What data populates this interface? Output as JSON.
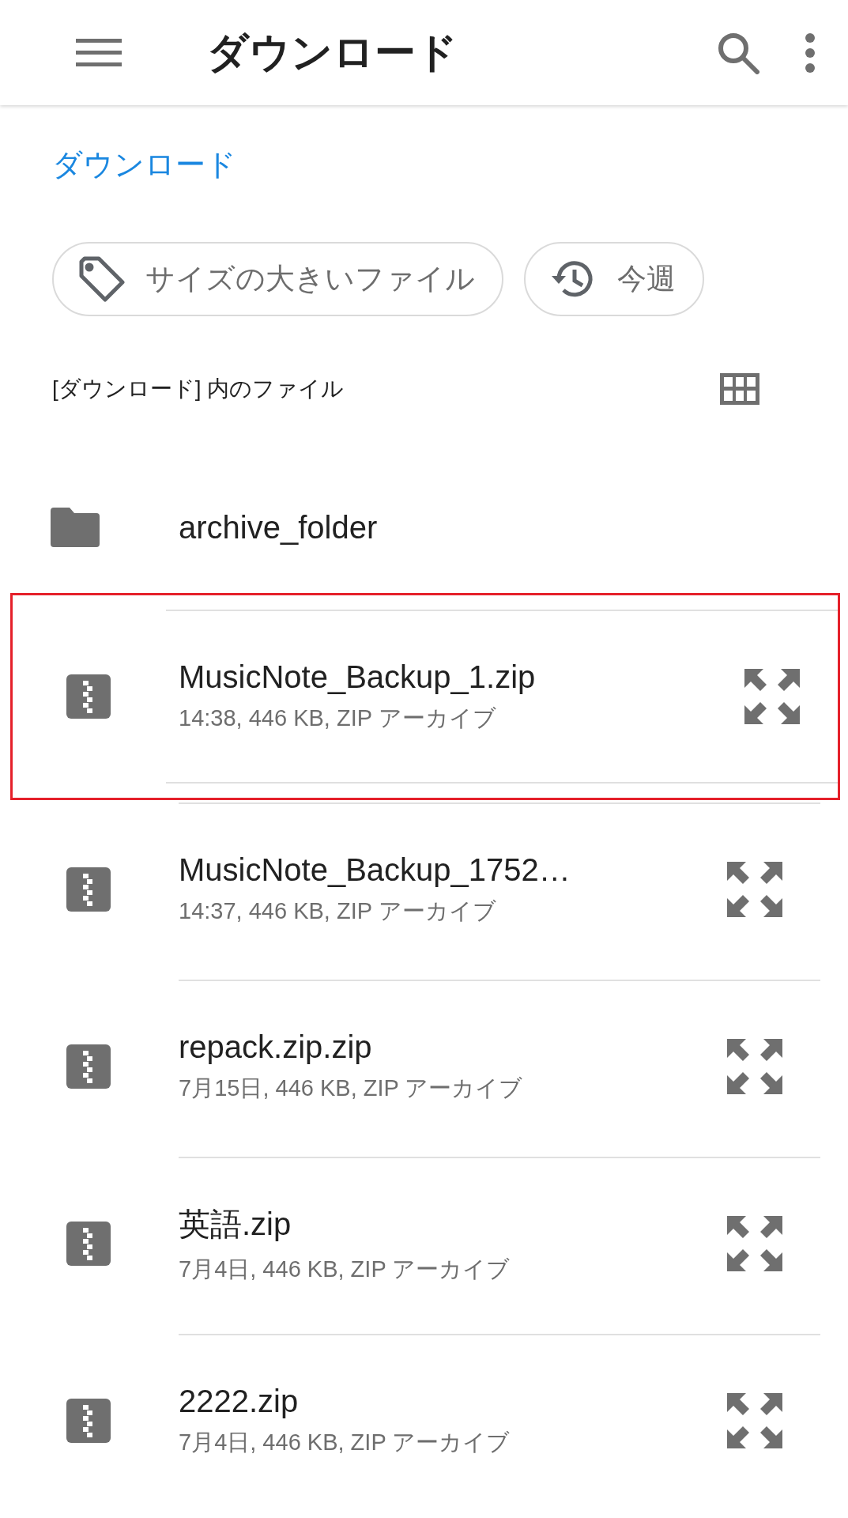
{
  "app_bar": {
    "title": "ダウンロード"
  },
  "breadcrumb": "ダウンロード",
  "chips": [
    {
      "kind": "tag",
      "label": "サイズの大きいファイル"
    },
    {
      "kind": "history",
      "label": "今週"
    }
  ],
  "section_label": "[ダウンロード] 内のファイル",
  "items": [
    {
      "kind": "folder",
      "name": "archive_folder",
      "highlighted": false
    },
    {
      "kind": "zip",
      "name": "MusicNote_Backup_1.zip",
      "meta": "14:38, 446 KB, ZIP アーカイブ",
      "highlighted": true
    },
    {
      "kind": "zip",
      "name": "MusicNote_Backup_1752…",
      "meta": "14:37, 446 KB, ZIP アーカイブ",
      "highlighted": false
    },
    {
      "kind": "zip",
      "name": "repack.zip.zip",
      "meta": "7月15日, 446 KB, ZIP アーカイブ",
      "highlighted": false
    },
    {
      "kind": "zip",
      "name": "英語.zip",
      "meta": "7月4日, 446 KB, ZIP アーカイブ",
      "highlighted": false
    },
    {
      "kind": "zip",
      "name": "2222.zip",
      "meta": "7月4日, 446 KB, ZIP アーカイブ",
      "highlighted": false
    }
  ]
}
